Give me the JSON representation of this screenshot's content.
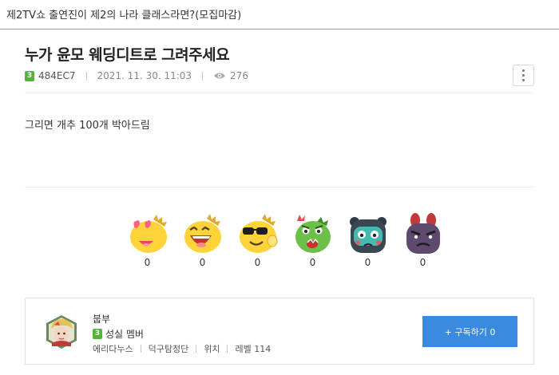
{
  "board": {
    "title": "제2TV쇼 출연진이 제2의 나라 클래스라면?(모집마감)"
  },
  "post": {
    "title": "누가 윤모 웨딩디트로 그려주세요",
    "author_level": "3",
    "author_id": "484EC7",
    "datetime": "2021. 11. 30. 11:03",
    "views": "276",
    "body": "그리면 개추 100개 박아드림"
  },
  "reactions": [
    {
      "icon": "heart-eyes-dino-icon",
      "count": "0"
    },
    {
      "icon": "laughing-dino-icon",
      "count": "0"
    },
    {
      "icon": "sunglasses-dino-icon",
      "count": "0"
    },
    {
      "icon": "angry-green-dino-icon",
      "count": "0"
    },
    {
      "icon": "crying-bear-icon",
      "count": "0"
    },
    {
      "icon": "angry-purple-bunny-icon",
      "count": "0"
    }
  ],
  "author": {
    "nickname": "붑부",
    "level": "3",
    "rank": "성실 멤버",
    "info": [
      "에리다누스",
      "덕구탐정단",
      "위치",
      "레벨 114"
    ],
    "subscribe_label": "+ 구독하기 0"
  },
  "colors": {
    "accent": "#3a8ae0",
    "level_badge": "#53b33b"
  }
}
